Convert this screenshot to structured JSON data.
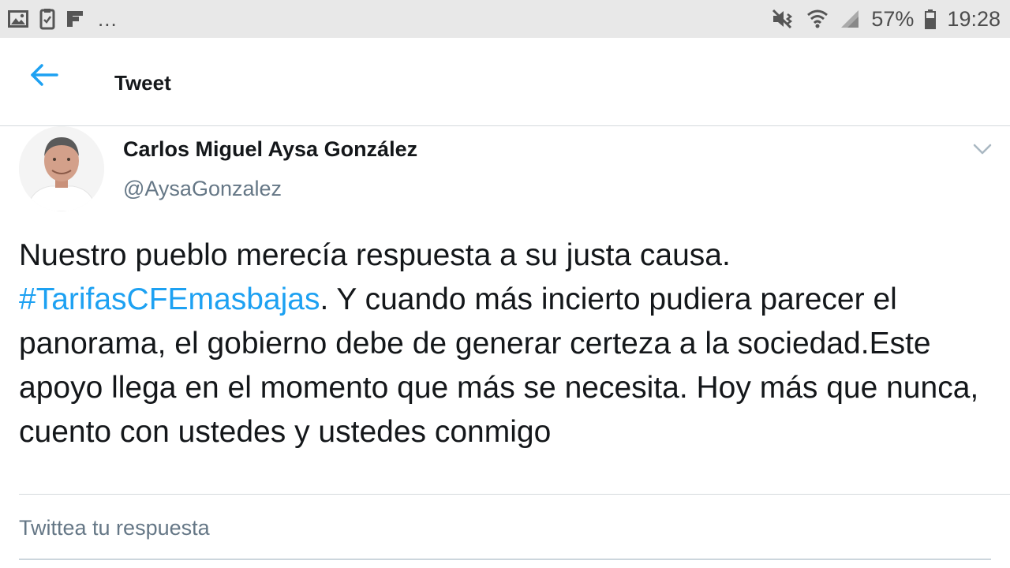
{
  "status_bar": {
    "battery_percent": "57%",
    "time": "19:28",
    "overflow_indicator": "...",
    "icons_left": [
      "gallery-icon",
      "clipboard-check-icon",
      "flipboard-icon"
    ],
    "icons_right": [
      "mute-vibrate-icon",
      "wifi-icon",
      "signal-icon",
      "battery-icon"
    ]
  },
  "header": {
    "title": "Tweet"
  },
  "tweet": {
    "author_name": "Carlos Miguel Aysa González",
    "author_handle": "@AysaGonzalez",
    "text_part1": "Nuestro pueblo merecía respuesta a su justa causa.",
    "hashtag": "#TarifasCFEmasbajas",
    "text_part2": ". Y cuando más incierto pudiera parecer el panorama, el gobierno debe de generar certeza a la sociedad.Este apoyo llega en el momento que más se necesita. Hoy más que nunca, cuento con ustedes y ustedes conmigo"
  },
  "reply": {
    "placeholder": "Twittea tu respuesta"
  },
  "colors": {
    "accent": "#1da1f2",
    "text_primary": "#14171a",
    "text_secondary": "#657786",
    "status_bar_bg": "#e8e8e8"
  }
}
